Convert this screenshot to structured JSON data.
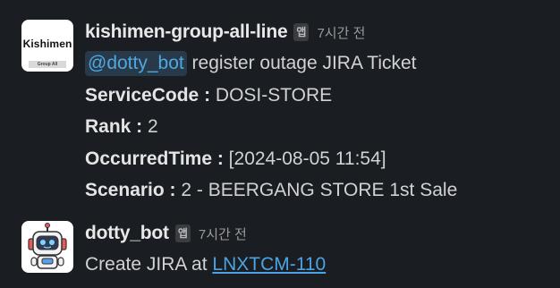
{
  "messages": [
    {
      "sender": "kishimen-group-all-line",
      "badge": "앱",
      "time": "7시간 전",
      "avatar": {
        "text": "Kishimen",
        "subtext": "Group All"
      },
      "mention": "@dotty_bot",
      "first_line_text": " register outage JIRA Ticket",
      "fields": [
        {
          "key": "ServiceCode :",
          "value": " DOSI-STORE"
        },
        {
          "key": "Rank :",
          "value": " 2"
        },
        {
          "key": "OccurredTime :",
          "value": " [2024-08-05 11:54]"
        },
        {
          "key": "Scenario :",
          "value": " 2 - BEERGANG STORE 1st Sale"
        }
      ]
    },
    {
      "sender": "dotty_bot",
      "badge": "앱",
      "time": "7시간 전",
      "avatar": {
        "icon": "robot-icon"
      },
      "text": "Create JIRA at ",
      "link_text": "LNXTCM-110"
    }
  ],
  "colors": {
    "background": "#1a1d21",
    "text": "#d1d2d3",
    "link": "#4aa4e4",
    "mention_bg": "#283a4a"
  }
}
